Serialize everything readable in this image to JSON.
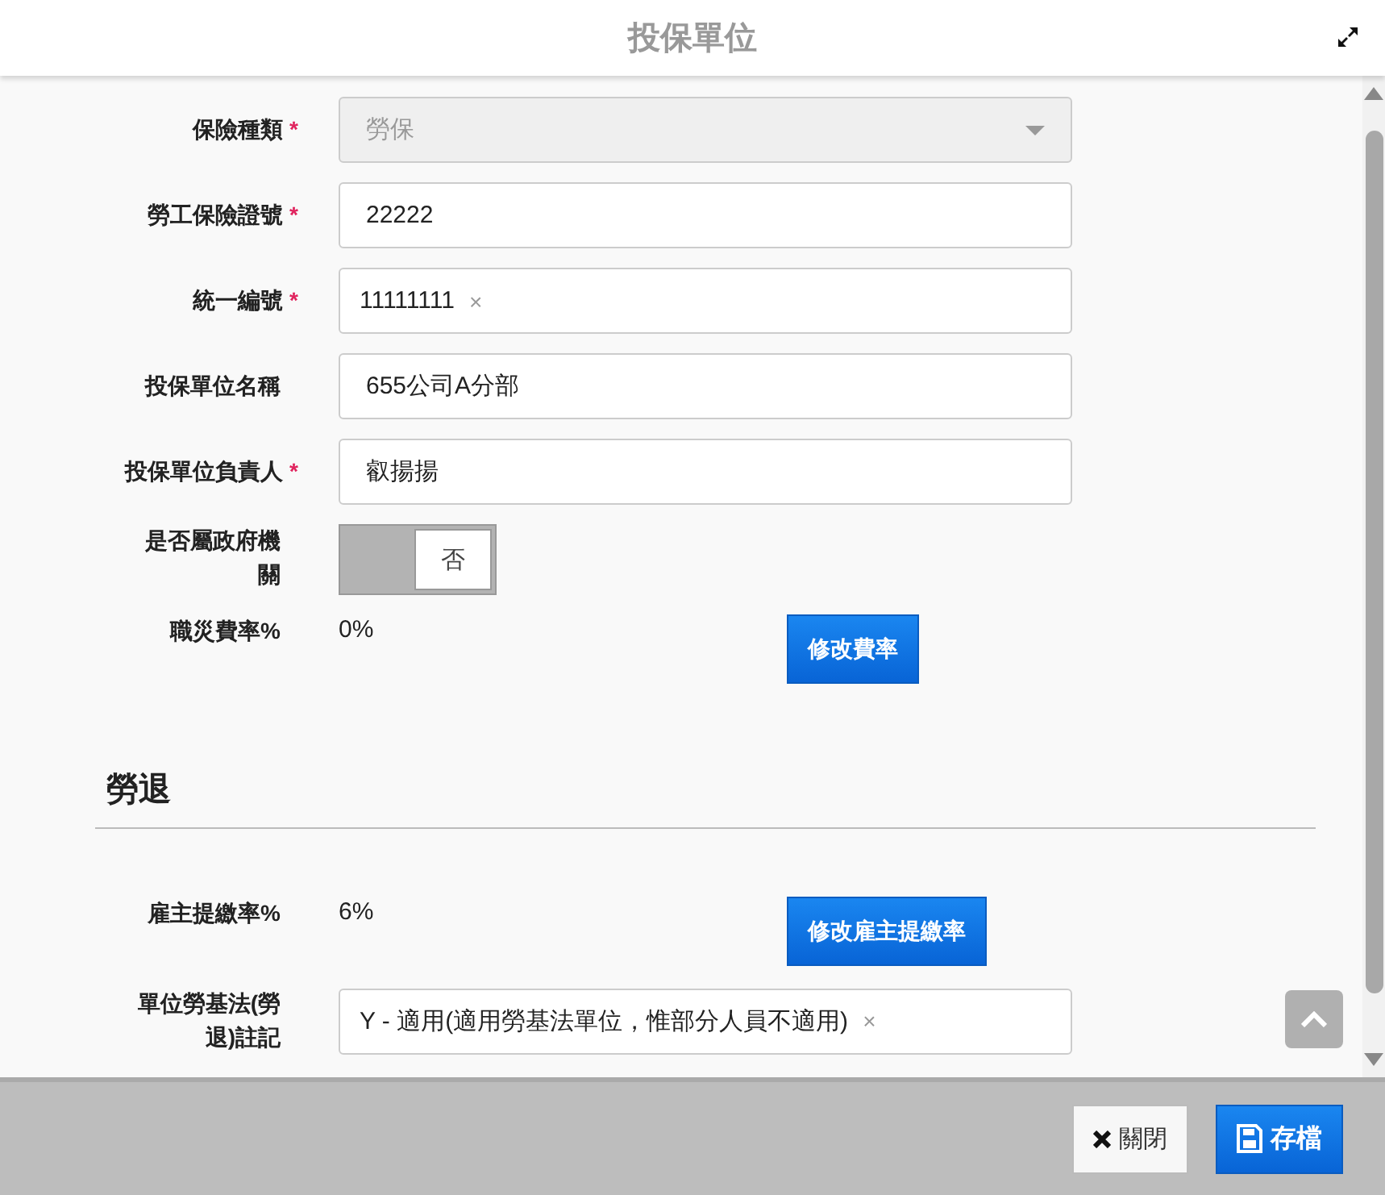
{
  "window": {
    "title": "投保單位"
  },
  "fields": [
    {
      "kind": "select",
      "label": "保險種類",
      "required_mark": "*",
      "value": "勞保",
      "disabled": true
    },
    {
      "kind": "input",
      "label": "勞工保險證號",
      "required_mark": "*",
      "value": "22222"
    },
    {
      "kind": "tag",
      "label": "統一編號",
      "required_mark": "*",
      "value": "11111111",
      "remove": "×"
    },
    {
      "kind": "input",
      "label": "投保單位名稱",
      "value": "655公司A分部"
    },
    {
      "kind": "input",
      "label": "投保單位負責人",
      "required_mark": "*",
      "value": "叡揚揚"
    },
    {
      "kind": "toggle",
      "label": "是否屬政府機關",
      "on": false,
      "value": "否"
    },
    {
      "kind": "rate",
      "label": "職災費率%",
      "value": "0%",
      "button": "修改費率"
    }
  ],
  "section": {
    "title": "勞退",
    "fields": [
      {
        "kind": "rate",
        "label": "雇主提繳率%",
        "value": "6%",
        "button": "修改雇主提繳率"
      },
      {
        "kind": "tag",
        "label": "單位勞基法(勞退)註記",
        "value": "Y - 適用(適用勞基法單位，惟部分人員不適用)",
        "remove": "×"
      }
    ]
  },
  "footer": {
    "buttons": [
      {
        "kind": "close",
        "label": "關閉"
      },
      {
        "kind": "save",
        "label": "存檔"
      }
    ]
  }
}
